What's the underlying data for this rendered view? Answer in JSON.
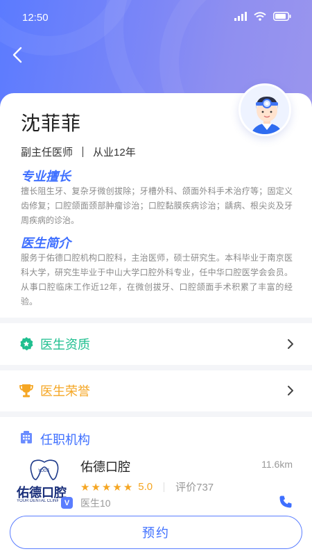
{
  "status_bar": {
    "time": "12:50"
  },
  "doctor": {
    "name": "沈菲菲",
    "title": "副主任医师",
    "experience": "从业12年"
  },
  "specialty": {
    "heading": "专业擅长",
    "text": "擅长阻生牙、复杂牙微创拔除；牙槽外科、颌面外科手术治疗等；固定义齿修复；口腔颌面颈部肿瘤诊治；口腔黏膜疾病诊治；龋病、根尖炎及牙周疾病的诊治。"
  },
  "bio": {
    "heading": "医生简介",
    "text": "服务于佑德口腔机构口腔科，主治医师，硕士研究生。本科毕业于南京医科大学，研究生毕业于中山大学口腔外科专业，任中华口腔医学会会员。从事口腔临床工作近12年，在微创拔牙、口腔颌面手术积累了丰富的经验。"
  },
  "rows": {
    "qualification": {
      "label": "医生资质",
      "color": "#1fbf8f"
    },
    "honors": {
      "label": "医生荣誉",
      "color": "#f5a623"
    }
  },
  "institution": {
    "heading": "任职机构",
    "name": "佑德口腔",
    "distance": "11.6km",
    "rating": 5.0,
    "score_text": "5.0",
    "review_text": "评价737",
    "doctor_count": "医生10",
    "logo_text": "佑德口腔",
    "logo_sub": "YOUR DENTAL CLINIC",
    "logo_badge": "V"
  },
  "book_button": {
    "label": "预约"
  },
  "colors": {
    "accent": "#3e6fff",
    "star": "#f5a623",
    "header_start": "#5b7bff",
    "header_end": "#9a95ee"
  }
}
